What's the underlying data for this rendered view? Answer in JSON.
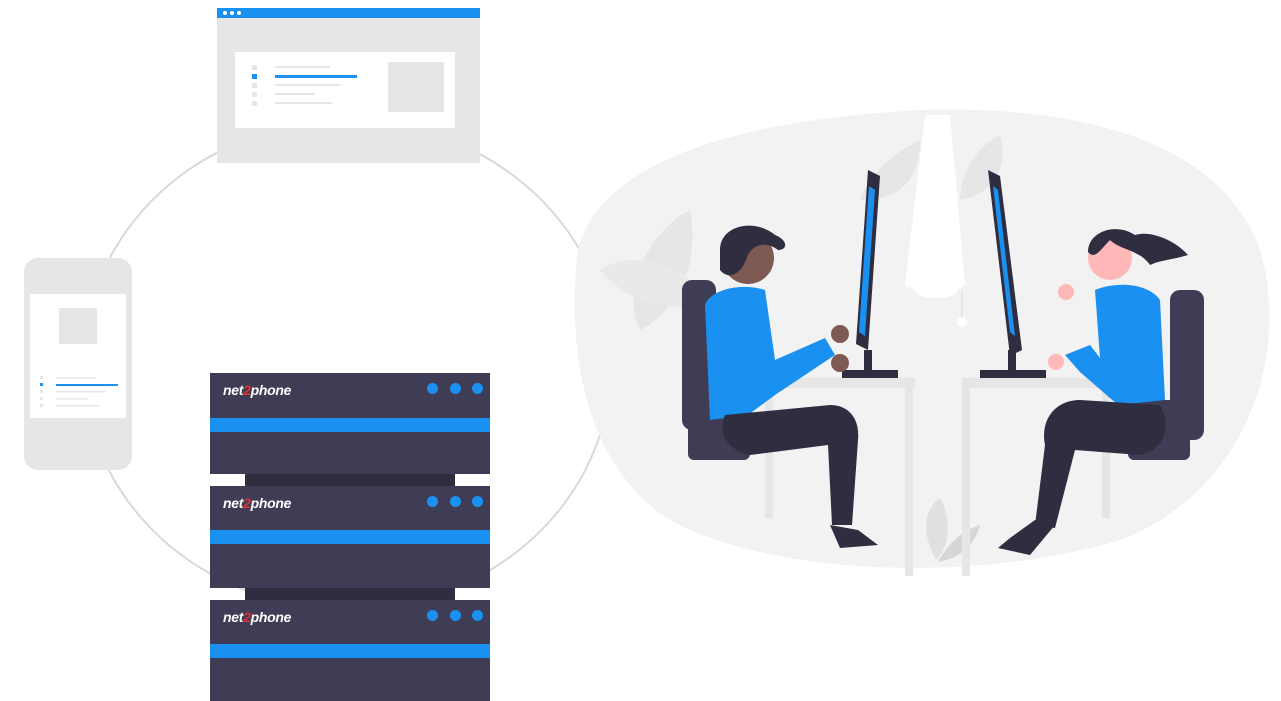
{
  "servers": [
    {
      "brand_prefix": "net",
      "brand_accent": "2",
      "brand_suffix": "phone"
    },
    {
      "brand_prefix": "net",
      "brand_accent": "2",
      "brand_suffix": "phone"
    },
    {
      "brand_prefix": "net",
      "brand_accent": "2",
      "brand_suffix": "phone"
    }
  ],
  "colors": {
    "accent_blue": "#1a91f0",
    "server_dark": "#3f3d56",
    "device_gray": "#e6e6e6",
    "brand_red": "#e5312f"
  },
  "icons": {
    "illustration": "office-workers-illustration"
  }
}
